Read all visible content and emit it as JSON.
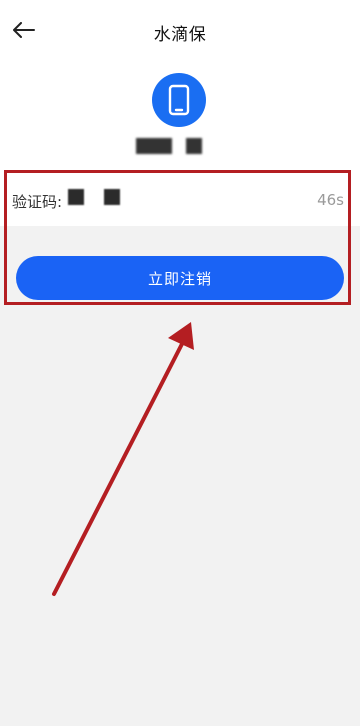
{
  "app": {
    "title": "水滴保"
  },
  "verify": {
    "label": "验证码:",
    "countdown": "46s"
  },
  "actions": {
    "submit_label": "立即注销"
  },
  "colors": {
    "primary": "#1a63f5",
    "annotation": "#b41e22"
  },
  "icons": {
    "back": "arrow-left",
    "phone": "mobile-phone"
  }
}
